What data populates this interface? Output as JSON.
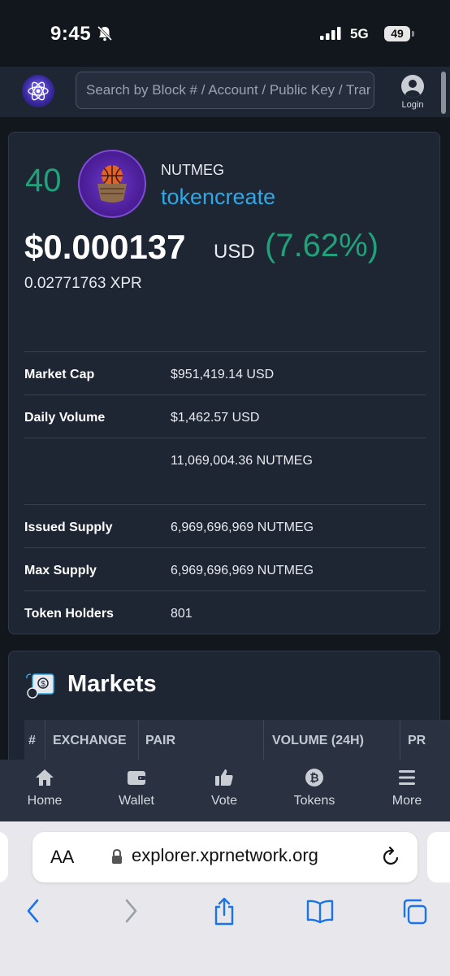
{
  "status_bar": {
    "time": "9:45",
    "network": "5G",
    "battery": "49"
  },
  "header": {
    "search_placeholder": "Search by Block # / Account / Public Key / Transaction ID",
    "login_label": "Login"
  },
  "token": {
    "rank": "40",
    "symbol": "NUTMEG",
    "account": "tokencreate",
    "price": "$0.000137",
    "price_unit": "USD",
    "price_change": "(7.62%)",
    "price_xpr": "0.02771763 XPR"
  },
  "stats": [
    {
      "label": "Market Cap",
      "value": "$951,419.14 USD"
    },
    {
      "label": "Daily Volume",
      "value": "$1,462.57 USD"
    },
    {
      "label": "",
      "value": "11,069,004.36 NUTMEG"
    },
    {
      "label": "Issued Supply",
      "value": "6,969,696,969 NUTMEG"
    },
    {
      "label": "Max Supply",
      "value": "6,969,696,969 NUTMEG"
    },
    {
      "label": "Token Holders",
      "value": "801"
    }
  ],
  "markets": {
    "title": "Markets",
    "columns": [
      "#",
      "EXCHANGE",
      "PAIR",
      "VOLUME (24H)",
      "PR"
    ]
  },
  "bottom_nav": [
    {
      "label": "Home",
      "icon": "home-icon"
    },
    {
      "label": "Wallet",
      "icon": "wallet-icon"
    },
    {
      "label": "Vote",
      "icon": "thumbs-up-icon"
    },
    {
      "label": "Tokens",
      "icon": "bitcoin-icon"
    },
    {
      "label": "More",
      "icon": "menu-icon"
    }
  ],
  "browser": {
    "aa_label": "AA",
    "url": "explorer.xprnetwork.org"
  },
  "colors": {
    "positive": "#1fa27a",
    "link": "#2ea8e6",
    "card": "#1e2533",
    "background": "#12161d"
  }
}
